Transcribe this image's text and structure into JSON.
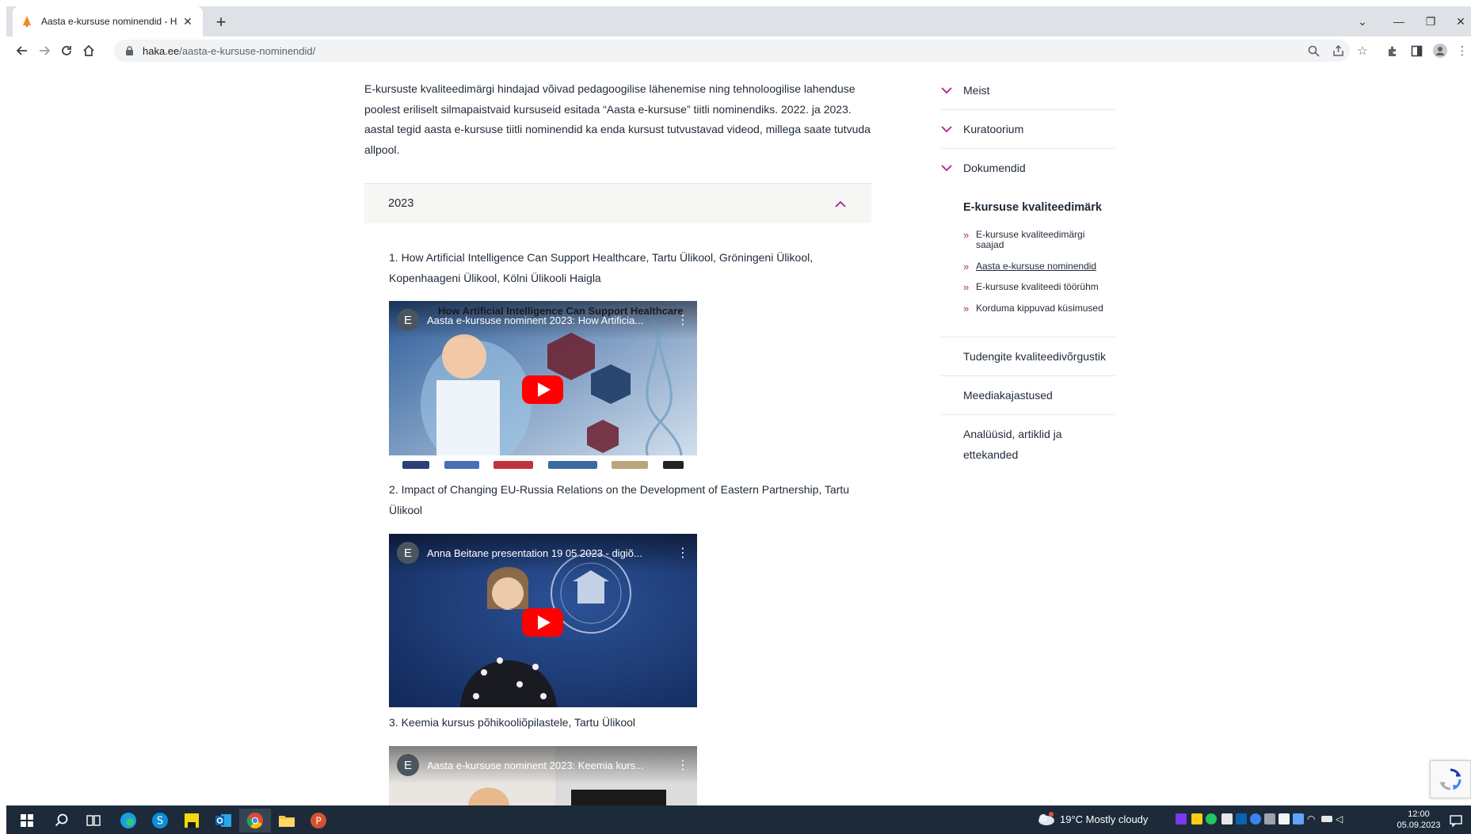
{
  "browser": {
    "tab_title": "Aasta e-kursuse nominendid - HA",
    "url_domain": "haka.ee",
    "url_path": "/aasta-e-kursuse-nominendid/"
  },
  "content": {
    "intro": "E-kursuste kvaliteedimärgi hindajad võivad pedagoogilise lähenemise ning tehnoloogilise lahenduse poolest eriliselt silmapaistvaid kursuseid esitada “Aasta e-kursuse” tiitli nominendiks. 2022. ja 2023. aastal tegid aasta e-kursuse tiitli nominendid ka enda kursust tutvustavad videod, millega saate tutvuda allpool.",
    "accordion_title": "2023",
    "nominees": [
      {
        "text": "1. How Artificial Intelligence Can Support Healthcare, Tartu Ülikool, Gröningeni Ülikool, Kopenhaageni Ülikool, Kölni Ülikooli Haigla",
        "video_title": "Aasta e-kursuse nominent 2023: How Artificia...",
        "video_banner": "How Artificial Intelligence Can Support Healthcare",
        "channel_initial": "E"
      },
      {
        "text": "2. Impact of Changing EU-Russia Relations on the Development of Eastern Partnership, Tartu Ülikool",
        "video_title": "Anna Beitane presentation 19 05 2023 - digiõ...",
        "channel_initial": "E"
      },
      {
        "text": "3. Keemia kursus põhikooliõpilastele, Tartu Ülikool",
        "video_title": "Aasta e-kursuse nominent 2023: Keemia kurs...",
        "channel_initial": "E"
      }
    ]
  },
  "sidebar": {
    "items": [
      "Meist",
      "Kuratoorium",
      "Dokumendid"
    ],
    "active_section": "E-kursuse kvaliteedimärk",
    "sub_items": [
      "E-kursuse kvaliteedimärgi saajad",
      "Aasta e-kursuse nominendid",
      "E-kursuse kvaliteedi töörühm",
      "Korduma kippuvad küsimused"
    ],
    "plain_items": [
      "Tudengite kvaliteedivõrgustik",
      "Meediakajastused",
      "Analüüsid, artiklid ja ettekanded"
    ]
  },
  "taskbar": {
    "weather": "19°C  Mostly cloudy",
    "time": "12:00",
    "date": "05.09.2023"
  },
  "colors": {
    "accent": "#b0228a",
    "text": "#1f2a37",
    "taskbar": "#1c2a3a"
  }
}
